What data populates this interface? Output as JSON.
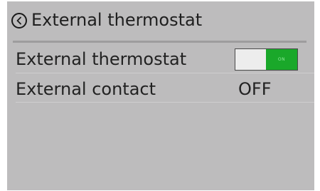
{
  "header": {
    "title": "External thermostat",
    "back_icon": "chevron-left-circle-icon"
  },
  "settings": [
    {
      "label": "External thermostat",
      "control": "toggle",
      "state": "ON",
      "on_color": "#1aa82a"
    },
    {
      "label": "External contact",
      "control": "value",
      "value": "OFF"
    }
  ],
  "colors": {
    "screen_background": "#bdbcbd",
    "toggle_on": "#1aa82a"
  }
}
